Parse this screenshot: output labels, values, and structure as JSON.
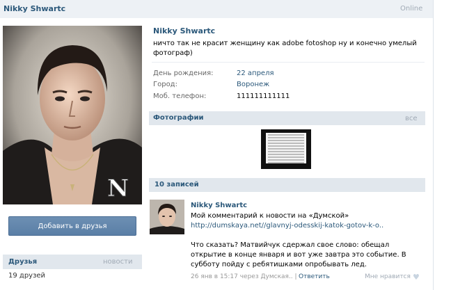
{
  "header": {
    "name": "Nikky Shwartc",
    "status_online": "Online"
  },
  "profile": {
    "name": "Nikky Shwartc",
    "status": "ничто так не красит женщину как adobe fotoshop ну и конечно умелый фотограф)",
    "info": [
      {
        "label": "День рождения:",
        "value": "22 апреля",
        "is_link": true
      },
      {
        "label": "Город:",
        "value": "Воронеж",
        "is_link": true
      },
      {
        "label": "Моб. телефон:",
        "value": "111111111111",
        "is_link": false
      }
    ]
  },
  "actions": {
    "add_friend": "Добавить в друзья"
  },
  "friends": {
    "title": "Друзья",
    "new_label": "новости",
    "count_text": "19 друзей"
  },
  "photos": {
    "title": "Фотографии",
    "all_label": "все"
  },
  "wall": {
    "title": "10 записей",
    "posts": [
      {
        "author": "Nikky Shwartc",
        "text_prefix": "Мой комментарий к новости на «Думской» ",
        "link_text": "http://dumskaya.net//glavnyj-odesskij-katok-gotov-k-o..",
        "body": "Что сказать? Матвийчук сдержал свое слово: обещал открытие в конце января и вот уже завтра это событие. В субботу пойду с ребятишками опробывать лед.",
        "meta": "26 янв в 15:17 через Думская..",
        "separator": "|",
        "reply_label": "Ответить",
        "like_label": "Мне нравится"
      }
    ]
  },
  "icons": {
    "like": "heart-icon",
    "logo": "n-logo-mark"
  },
  "colors": {
    "accent": "#2b587a",
    "header_bg": "#edf1f5",
    "section_bg": "#e1e7ed",
    "button": "#5f84aa"
  }
}
